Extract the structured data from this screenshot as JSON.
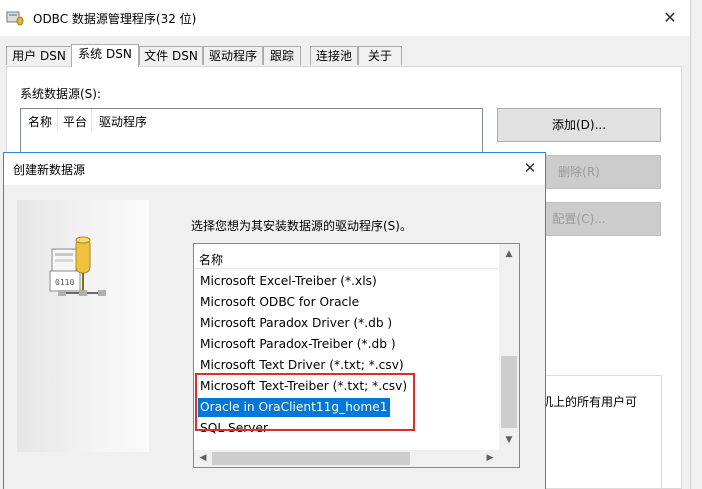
{
  "odbc_window": {
    "title": "ODBC 数据源管理程序(32 位)",
    "close_glyph": "✕",
    "tabs": [
      "用户 DSN",
      "系统 DSN",
      "文件 DSN",
      "驱动程序",
      "跟踪",
      "连接池",
      "关于"
    ],
    "active_tab": "系统 DSN",
    "system_ds_label": "系统数据源(S):",
    "list_columns": [
      "名称",
      "平台",
      "驱动程序"
    ],
    "buttons": {
      "add": "添加(D)...",
      "remove": "删除(R)",
      "configure": "配置(C)..."
    },
    "info_text": "机上的所有用户可"
  },
  "dialog": {
    "title": "创建新数据源",
    "close_glyph": "✕",
    "prompt": "选择您想为其安装数据源的驱动程序(S)。",
    "list_header": "名称",
    "drivers": [
      "Microsoft Excel-Treiber (*.xls)",
      "Microsoft ODBC for Oracle",
      "Microsoft Paradox Driver (*.db )",
      "Microsoft Paradox-Treiber (*.db )",
      "Microsoft Text Driver (*.txt; *.csv)",
      "Microsoft Text-Treiber (*.txt; *.csv)",
      "Oracle in OraClient11g_home1",
      "SQL Server"
    ],
    "selected_driver": "Oracle in OraClient11g_home1",
    "scroll_up_glyph": "▲",
    "scroll_down_glyph": "▼",
    "scroll_left_glyph": "◀",
    "scroll_right_glyph": "▶"
  },
  "colors": {
    "selection": "#0078d7",
    "annotation_box": "#d9302c",
    "dialog_border": "#2a8ad4"
  }
}
